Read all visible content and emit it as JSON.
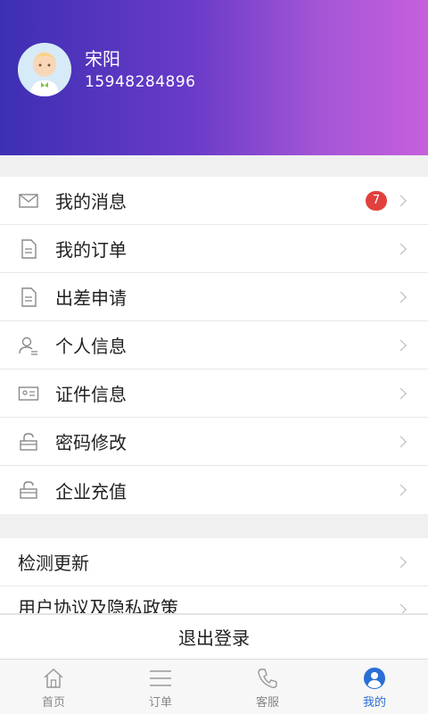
{
  "profile": {
    "name": "宋阳",
    "phone": "15948284896"
  },
  "menu_main": [
    {
      "label": "我的消息",
      "icon": "mail-icon",
      "badge": "7"
    },
    {
      "label": "我的订单",
      "icon": "document-icon"
    },
    {
      "label": "出差申请",
      "icon": "document-icon"
    },
    {
      "label": "个人信息",
      "icon": "user-icon"
    },
    {
      "label": "证件信息",
      "icon": "id-card-icon"
    },
    {
      "label": "密码修改",
      "icon": "lock-icon"
    },
    {
      "label": "企业充值",
      "icon": "lock-icon"
    }
  ],
  "menu_other": [
    {
      "label": "检测更新"
    },
    {
      "label": "用户协议及隐私政策"
    }
  ],
  "logout_label": "退出登录",
  "tabs": [
    {
      "label": "首页",
      "icon": "home-icon"
    },
    {
      "label": "订单",
      "icon": "list-icon"
    },
    {
      "label": "客服",
      "icon": "phone-icon"
    },
    {
      "label": "我的",
      "icon": "profile-icon",
      "active": true
    }
  ],
  "colors": {
    "header_gradient_start": "#3d2fb3",
    "header_gradient_end": "#c65fdc",
    "badge": "#e0413e",
    "tab_active": "#2a6fd6"
  }
}
